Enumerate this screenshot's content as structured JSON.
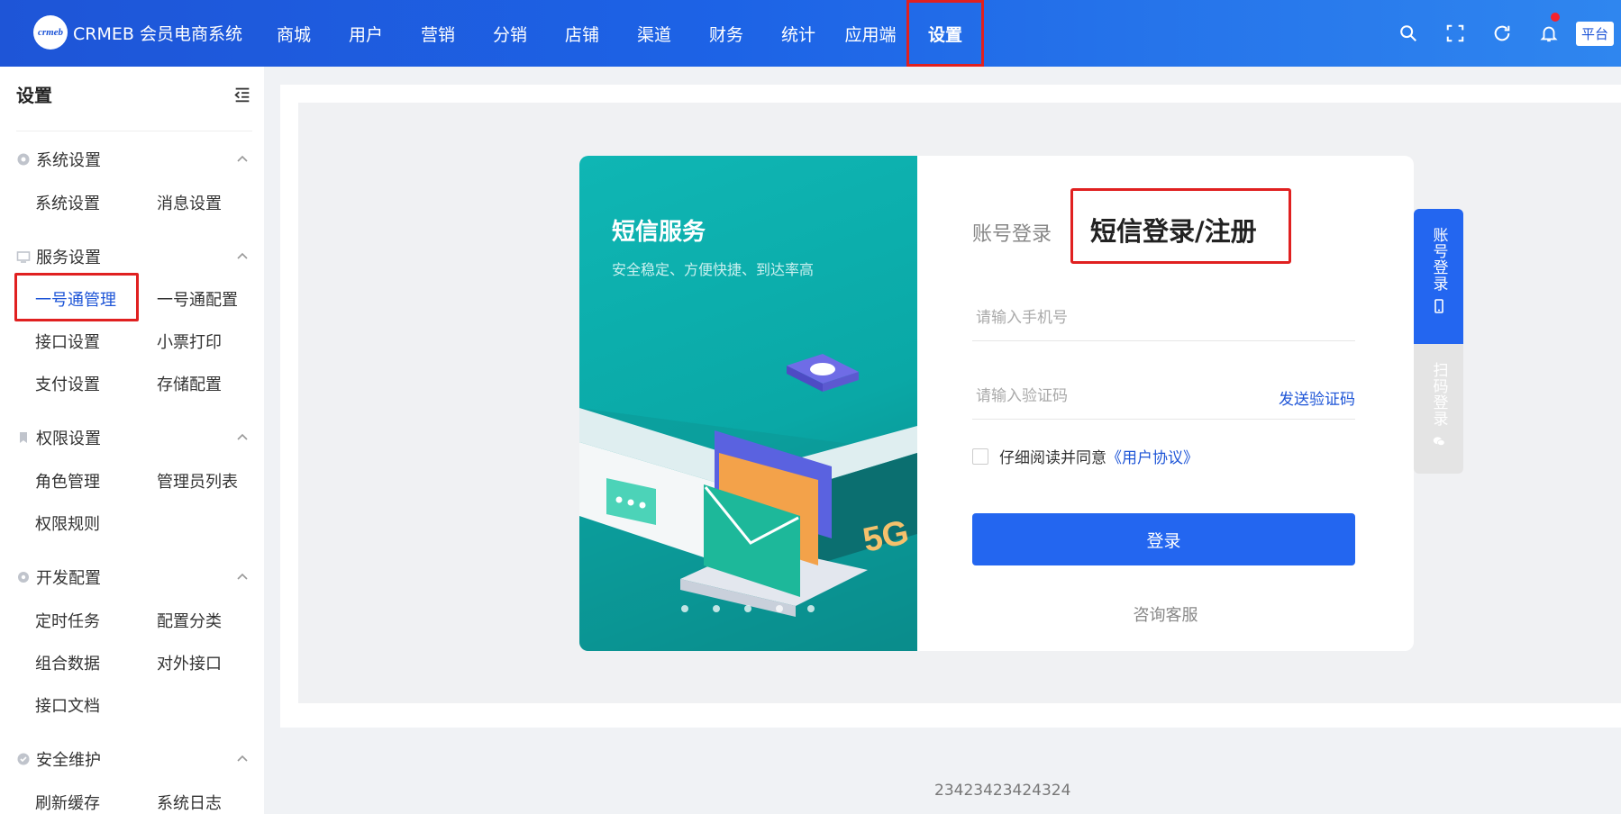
{
  "header": {
    "logo_text": "crmeb",
    "brand": "CRMEB 会员电商系统",
    "nav": [
      "商城",
      "用户",
      "营销",
      "分销",
      "店铺",
      "渠道",
      "财务",
      "统计",
      "应用端",
      "设置"
    ],
    "active_nav": "设置",
    "platform_badge": "平台",
    "icons": [
      "search-icon",
      "fullscreen-icon",
      "refresh-icon",
      "bell-icon"
    ]
  },
  "sidebar": {
    "title": "设置",
    "groups": [
      {
        "label": "系统设置",
        "items": [
          "系统设置",
          "消息设置"
        ]
      },
      {
        "label": "服务设置",
        "items": [
          "一号通管理",
          "一号通配置",
          "接口设置",
          "小票打印",
          "支付设置",
          "存储配置"
        ]
      },
      {
        "label": "权限设置",
        "items": [
          "角色管理",
          "管理员列表",
          "权限规则"
        ]
      },
      {
        "label": "开发配置",
        "items": [
          "定时任务",
          "配置分类",
          "组合数据",
          "对外接口",
          "接口文档"
        ]
      },
      {
        "label": "安全维护",
        "items": [
          "刷新缓存",
          "系统日志"
        ]
      }
    ],
    "active_item": "一号通管理"
  },
  "login": {
    "illus_title": "短信服务",
    "illus_subtitle": "安全稳定、方便快捷、到达率高",
    "illus_badge": "5G",
    "tab_account": "账号登录",
    "tab_sms": "短信登录/注册",
    "phone_placeholder": "请输入手机号",
    "code_placeholder": "请输入验证码",
    "send_code": "发送验证码",
    "agree_text": "仔细阅读并同意",
    "agree_link": "《用户协议》",
    "login_button": "登录",
    "consult": "咨询客服",
    "side_tab_account": "账号登录",
    "side_tab_scan": "扫码登录"
  },
  "footer": {
    "text": "23423423424324"
  }
}
